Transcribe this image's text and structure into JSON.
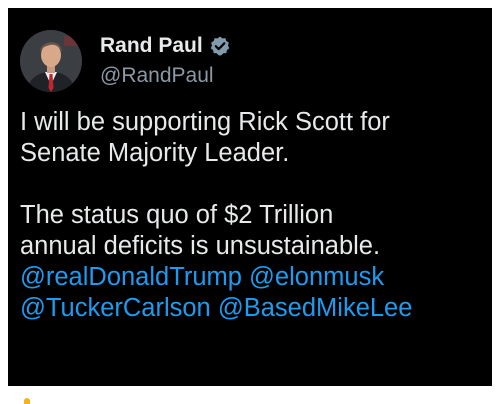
{
  "tweet": {
    "author": {
      "display_name": "Rand Paul",
      "handle": "@RandPaul",
      "verified": true,
      "avatar_icon": "profile-photo"
    },
    "text_lines": [
      "I will be supporting Rick Scott for",
      "Senate Majority Leader.",
      "",
      "The status quo of $2 Trillion",
      "annual deficits is unsustainable."
    ],
    "mentions": [
      "@realDonaldTrump",
      "@elonmusk",
      "@TuckerCarlson",
      "@BasedMikeLee"
    ]
  },
  "colors": {
    "background": "#000000",
    "text": "#e7e9ea",
    "secondary_text": "#8b98a5",
    "mention": "#1d9bf0",
    "verified_badge": "#829aab"
  }
}
